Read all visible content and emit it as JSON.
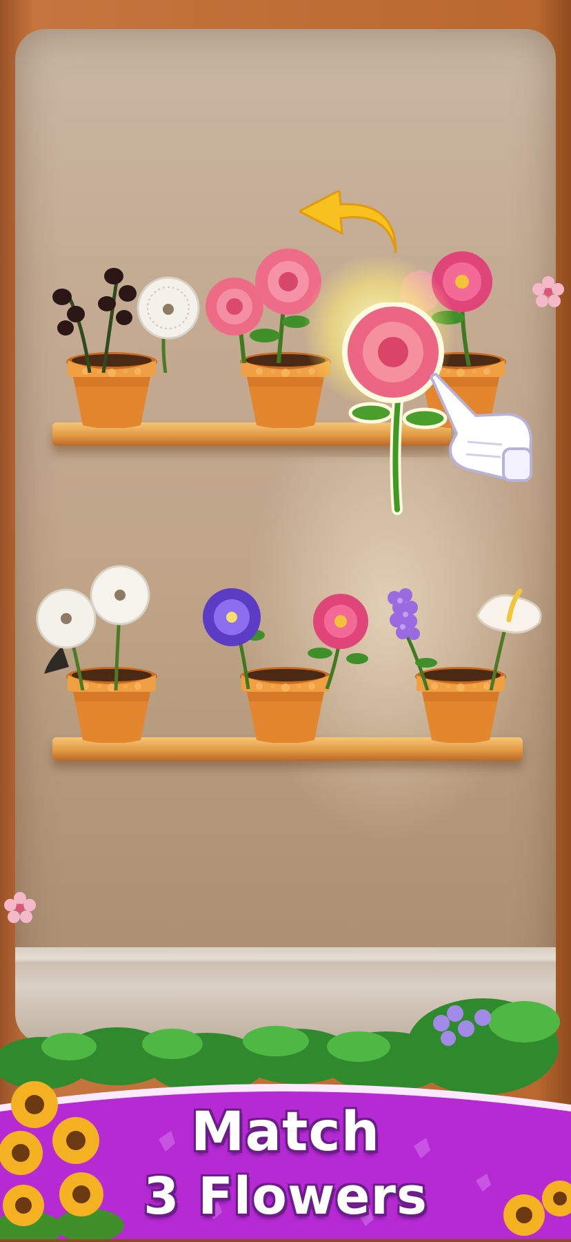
{
  "banner": {
    "line1": "Match",
    "line2": "3 Flowers"
  },
  "colors": {
    "banner_purple": "#b62ad4",
    "banner_light": "#f0c6ff",
    "title_text": "#ffffff",
    "shelf_wood": "#e29a43",
    "pot_terracotta": "#e2852e",
    "undo_arrow": "#f7c21f"
  },
  "shelves": [
    {
      "pots": [
        {
          "flowers": [
            "black-lily-of-the-valley",
            "white-dandelion"
          ]
        },
        {
          "flowers": [
            "pink-rose",
            "pink-rose"
          ]
        },
        {
          "flowers": [
            "pink-peony"
          ]
        }
      ]
    },
    {
      "pots": [
        {
          "flowers": [
            "white-dandelion",
            "white-dandelion"
          ]
        },
        {
          "flowers": [
            "purple-morning-glory",
            "pink-peony"
          ]
        },
        {
          "flowers": [
            "purple-hyacinth",
            "white-anthurium"
          ]
        }
      ]
    }
  ],
  "held_flower": "pink-rose",
  "icons": [
    "undo-arrow-icon",
    "pointing-hand-icon"
  ]
}
